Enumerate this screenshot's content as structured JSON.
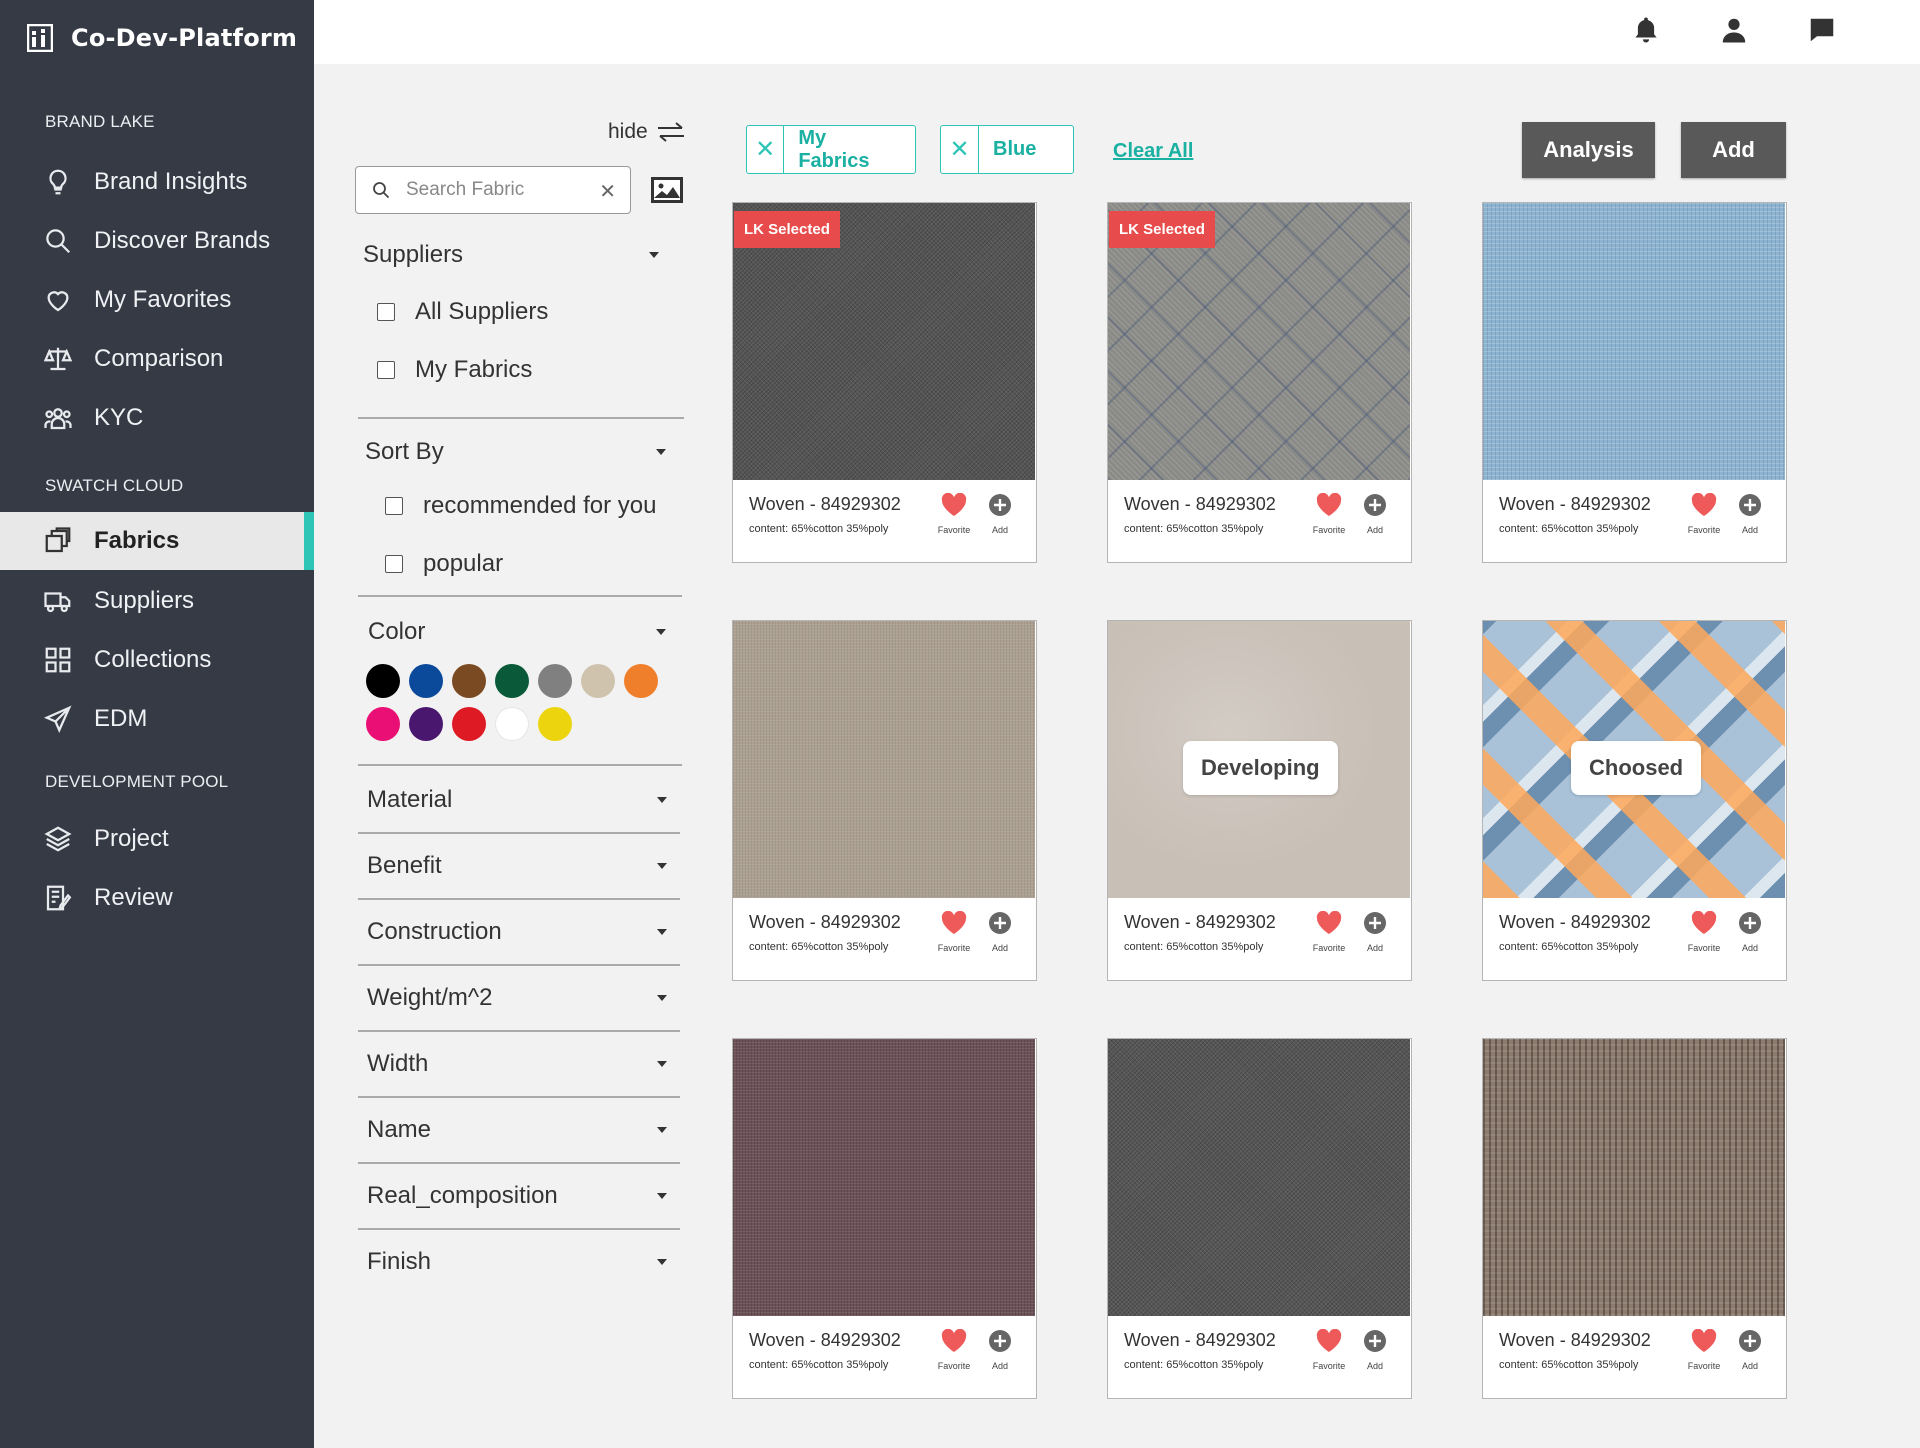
{
  "app": {
    "name": "Co-Dev-Platform"
  },
  "sidebar": {
    "sections": [
      {
        "title": "BRAND LAKE"
      },
      {
        "title": "SWATCH CLOUD"
      },
      {
        "title": "DEVELOPMENT POOL"
      }
    ],
    "items": [
      {
        "label": "Brand Insights",
        "icon": "lightbulb-icon"
      },
      {
        "label": "Discover Brands",
        "icon": "search-icon"
      },
      {
        "label": "My Favorites",
        "icon": "heart-icon"
      },
      {
        "label": "Comparison",
        "icon": "scale-icon"
      },
      {
        "label": "KYC",
        "icon": "people-icon"
      },
      {
        "label": "Fabrics",
        "icon": "fabrics-icon",
        "active": true
      },
      {
        "label": "Suppliers",
        "icon": "truck-icon"
      },
      {
        "label": "Collections",
        "icon": "grid-icon"
      },
      {
        "label": "EDM",
        "icon": "send-icon"
      },
      {
        "label": "Project",
        "icon": "layers-icon"
      },
      {
        "label": "Review",
        "icon": "review-icon"
      }
    ]
  },
  "filters": {
    "hide_label": "hide",
    "search_placeholder": "Search Fabric",
    "suppliers": {
      "title": "Suppliers",
      "options": [
        "All Suppliers",
        "My Fabrics"
      ]
    },
    "sort_by": {
      "title": "Sort By",
      "options": [
        "recommended for you",
        "popular"
      ]
    },
    "color": {
      "title": "Color",
      "swatches": [
        "#000000",
        "#0b4a9b",
        "#7a4a22",
        "#0a5a3a",
        "#808080",
        "#cfc3ae",
        "#f07f2b",
        "#ea0f74",
        "#4a176f",
        "#de1b25",
        "#ffffff",
        "#ecd50f"
      ]
    },
    "more": [
      "Material",
      "Benefit",
      "Construction",
      "Weight/m^2",
      "Width",
      "Name",
      "Real_composition",
      "Finish"
    ]
  },
  "chips": [
    {
      "label": "My Fabrics"
    },
    {
      "label": "Blue"
    }
  ],
  "clear_all": "Clear All",
  "actions": {
    "analysis": "Analysis",
    "add": "Add"
  },
  "card_labels": {
    "favorite": "Favorite",
    "add": "Add"
  },
  "cards": [
    {
      "title": "Woven - 84929302",
      "content": "content: 65%cotton 35%poly",
      "tag": "LK Selected",
      "overlay": null
    },
    {
      "title": "Woven - 84929302",
      "content": "content: 65%cotton 35%poly",
      "tag": "LK Selected",
      "overlay": null
    },
    {
      "title": "Woven - 84929302",
      "content": "content: 65%cotton 35%poly",
      "tag": null,
      "overlay": null
    },
    {
      "title": "Woven - 84929302",
      "content": "content: 65%cotton 35%poly",
      "tag": null,
      "overlay": null
    },
    {
      "title": "Woven - 84929302",
      "content": "content: 65%cotton 35%poly",
      "tag": null,
      "overlay": "Developing"
    },
    {
      "title": "Woven - 84929302",
      "content": "content: 65%cotton 35%poly",
      "tag": null,
      "overlay": "Choosed"
    },
    {
      "title": "Woven - 84929302",
      "content": "content: 65%cotton 35%poly",
      "tag": null,
      "overlay": null
    },
    {
      "title": "Woven - 84929302",
      "content": "content: 65%cotton 35%poly",
      "tag": null,
      "overlay": null
    },
    {
      "title": "Woven - 84929302",
      "content": "content: 65%cotton 35%poly",
      "tag": null,
      "overlay": null
    }
  ],
  "colors": {
    "accent": "#2ec4b6",
    "tag_red": "#e84b4b",
    "sidebar_bg": "#353a45",
    "heart": "#ee5a5a"
  }
}
